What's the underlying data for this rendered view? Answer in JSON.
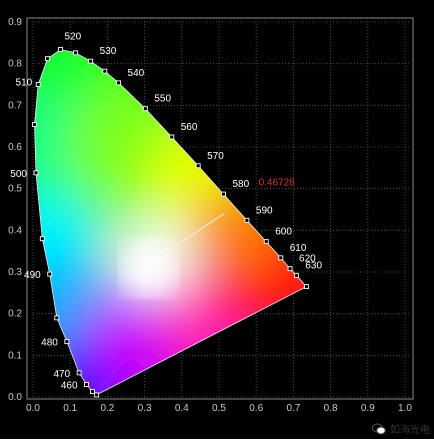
{
  "chart_data": {
    "type": "scatter",
    "title": "",
    "xlabel": "",
    "ylabel": "",
    "xlim": [
      0,
      1
    ],
    "ylim": [
      0,
      0.9
    ],
    "x_ticks": [
      "0.0",
      "0.1",
      "0.2",
      "0.3",
      "0.4",
      "0.5",
      "0.6",
      "0.7",
      "0.8",
      "0.9",
      "1.0"
    ],
    "y_ticks": [
      "0.0",
      "0.1",
      "0.2",
      "0.3",
      "0.4",
      "0.5",
      "0.6",
      "0.7",
      "0.8",
      "0.9"
    ],
    "grid": true,
    "spectral_locus": [
      {
        "nm": "460",
        "x": 0.144,
        "y": 0.03
      },
      {
        "nm": "470",
        "x": 0.124,
        "y": 0.058
      },
      {
        "nm": "480",
        "x": 0.091,
        "y": 0.133
      },
      {
        "nm": "490",
        "x": 0.045,
        "y": 0.295
      },
      {
        "nm": "500",
        "x": 0.008,
        "y": 0.538
      },
      {
        "nm": "510",
        "x": 0.014,
        "y": 0.75
      },
      {
        "nm": "520",
        "x": 0.074,
        "y": 0.834
      },
      {
        "nm": "530",
        "x": 0.155,
        "y": 0.806
      },
      {
        "nm": "540",
        "x": 0.23,
        "y": 0.754
      },
      {
        "nm": "550",
        "x": 0.302,
        "y": 0.692
      },
      {
        "nm": "560",
        "x": 0.373,
        "y": 0.624
      },
      {
        "nm": "570",
        "x": 0.444,
        "y": 0.555
      },
      {
        "nm": "580",
        "x": 0.512,
        "y": 0.487
      },
      {
        "nm": "590",
        "x": 0.575,
        "y": 0.424
      },
      {
        "nm": "600",
        "x": 0.627,
        "y": 0.373
      },
      {
        "nm": "610",
        "x": 0.666,
        "y": 0.334
      },
      {
        "nm": "620",
        "x": 0.691,
        "y": 0.308
      },
      {
        "nm": "630",
        "x": 0.708,
        "y": 0.292
      }
    ],
    "series": [
      {
        "values": [
          {
            "x": 0.171,
            "y": 0.005
          },
          {
            "x": 0.16,
            "y": 0.013
          },
          {
            "x": 0.144,
            "y": 0.03
          },
          {
            "x": 0.124,
            "y": 0.058
          },
          {
            "x": 0.091,
            "y": 0.133
          },
          {
            "x": 0.064,
            "y": 0.19
          },
          {
            "x": 0.045,
            "y": 0.295
          },
          {
            "x": 0.025,
            "y": 0.38
          },
          {
            "x": 0.008,
            "y": 0.538
          },
          {
            "x": 0.004,
            "y": 0.654
          },
          {
            "x": 0.014,
            "y": 0.75
          },
          {
            "x": 0.039,
            "y": 0.812
          },
          {
            "x": 0.074,
            "y": 0.834
          },
          {
            "x": 0.114,
            "y": 0.826
          },
          {
            "x": 0.155,
            "y": 0.806
          },
          {
            "x": 0.193,
            "y": 0.782
          },
          {
            "x": 0.23,
            "y": 0.754
          },
          {
            "x": 0.302,
            "y": 0.692
          },
          {
            "x": 0.373,
            "y": 0.624
          },
          {
            "x": 0.444,
            "y": 0.555
          },
          {
            "x": 0.512,
            "y": 0.487
          },
          {
            "x": 0.575,
            "y": 0.424
          },
          {
            "x": 0.627,
            "y": 0.373
          },
          {
            "x": 0.666,
            "y": 0.334
          },
          {
            "x": 0.691,
            "y": 0.308
          },
          {
            "x": 0.708,
            "y": 0.292
          },
          {
            "x": 0.735,
            "y": 0.265
          }
        ]
      }
    ],
    "white_point": {
      "x": 0.333,
      "y": 0.333
    },
    "line_end": {
      "x": 0.515,
      "y": 0.441
    },
    "annotation": "0.46728"
  },
  "watermark": {
    "text": "如海光电"
  },
  "colors": {
    "background": "#000000",
    "grid": "#5a5a5a",
    "axis": "#bdbdbd",
    "annotation": "#d03a2a"
  }
}
